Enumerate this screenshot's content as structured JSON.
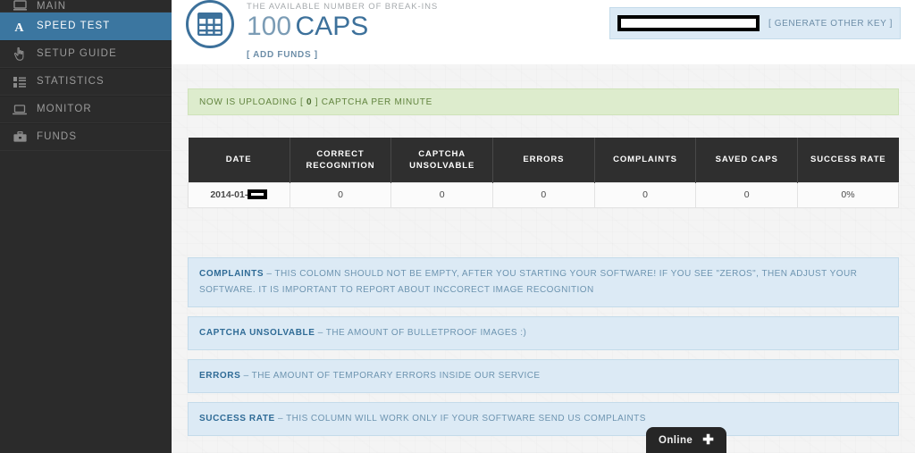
{
  "sidebar": {
    "items": [
      {
        "label": "MAIN",
        "icon": "home-icon",
        "active": false,
        "clipped": true
      },
      {
        "label": "SPEED TEST",
        "icon": "letter-a-icon",
        "active": true,
        "clipped": false
      },
      {
        "label": "SETUP GUIDE",
        "icon": "hand-pointer-icon",
        "active": false,
        "clipped": false
      },
      {
        "label": "STATISTICS",
        "icon": "list-icon",
        "active": false,
        "clipped": false
      },
      {
        "label": "MONITOR",
        "icon": "laptop-icon",
        "active": false,
        "clipped": false
      },
      {
        "label": "FUNDS",
        "icon": "briefcase-icon",
        "active": false,
        "clipped": false
      }
    ],
    "active_color": "#3b76a0",
    "background_color": "#2b2b2b"
  },
  "header": {
    "caps_icon": "table-grid-circle-icon",
    "subtitle": "THE AVAILABLE NUMBER OF BREAK-INS",
    "amount": "100",
    "unit": "CAPS",
    "add_funds_label": "[ ADD FUNDS ]",
    "api_key_value": "",
    "api_key_placeholder": "",
    "generate_key_label": "[ GENERATE OTHER KEY ]",
    "accent_color": "#3d719b"
  },
  "status": {
    "prefix": "NOW IS UPLOADING [",
    "value": "0",
    "suffix": "] CAPTCHA PER MINUTE",
    "background_color": "#ddeccd",
    "text_color": "#62843f"
  },
  "table": {
    "columns": [
      "DATE",
      "CORRECT RECOGNITION",
      "CAPTCHA UNSOLVABLE",
      "ERRORS",
      "COMPLAINTS",
      "SAVED CAPS",
      "SUCCESS RATE"
    ],
    "rows": [
      {
        "date": "2014-01-",
        "date_redacted": true,
        "correct_recognition": "0",
        "captcha_unsolvable": "0",
        "errors": "0",
        "complaints": "0",
        "saved_caps": "0",
        "success_rate": "0%"
      }
    ]
  },
  "info_boxes": [
    {
      "term": "COMPLAINTS",
      "description": "– THIS COLOMN SHOULD NOT BE EMPTY, AFTER YOU STARTING YOUR SOFTWARE! IF YOU SEE \"ZEROS\", THEN ADJUST YOUR SOFTWARE. IT IS IMPORTANT TO REPORT ABOUT INCCORECT IMAGE RECOGNITION"
    },
    {
      "term": "CAPTCHA UNSOLVABLE",
      "description": "– THE AMOUNT OF BULLETPROOF IMAGES :)"
    },
    {
      "term": "ERRORS",
      "description": "– THE AMOUNT OF TEMPORARY ERRORS INSIDE OUR SERVICE"
    },
    {
      "term": "SUCCESS RATE",
      "description": "– THIS COLUMN WILL WORK ONLY IF YOUR SOFTWARE SEND US COMPLAINTS"
    }
  ],
  "chat_widget": {
    "label": "Online",
    "icon": "plus-icon",
    "background_color": "#262626"
  }
}
